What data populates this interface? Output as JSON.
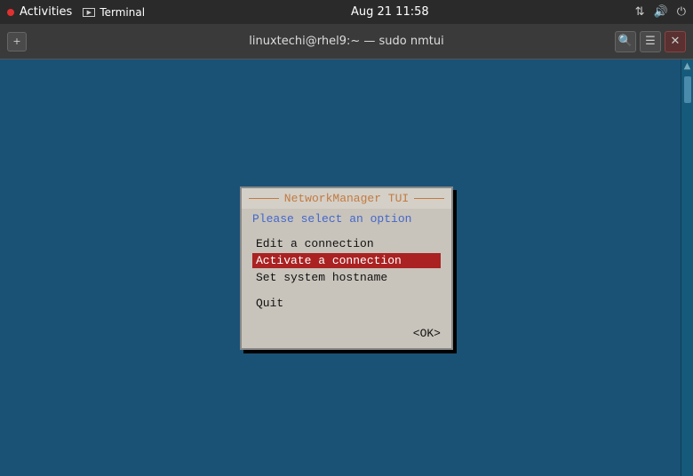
{
  "topbar": {
    "activities_label": "Activities",
    "terminal_label": "Terminal",
    "datetime": "Aug 21  11:58"
  },
  "terminal": {
    "title": "linuxtechi@rhel9:~ — sudo nmtui",
    "new_tab_icon": "⊞",
    "search_icon": "🔍",
    "menu_icon": "☰",
    "close_icon": "✕"
  },
  "nmtui": {
    "title": "NetworkManager TUI",
    "subtitle": "Please select an option",
    "menu_items": [
      {
        "label": "Edit a connection",
        "selected": false
      },
      {
        "label": "Activate a connection",
        "selected": true
      },
      {
        "label": "Set system hostname",
        "selected": false
      }
    ],
    "quit_label": "Quit",
    "ok_label": "<OK>"
  },
  "sysicons": {
    "network": "⇅",
    "volume": "🔊",
    "power": "⏻"
  }
}
